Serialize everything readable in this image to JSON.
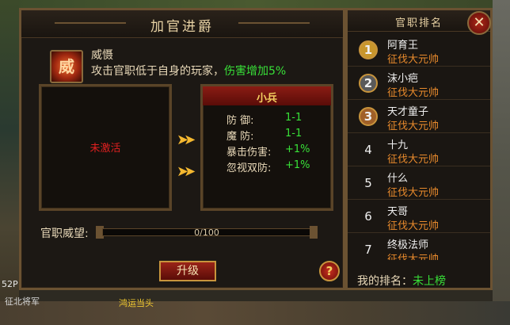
{
  "window": {
    "title": "加官进爵"
  },
  "skill": {
    "icon": "flame-skill-icon",
    "icon_glyph": "威",
    "name": "威慑",
    "desc_prefix": "攻击官职低于自身的玩家，",
    "desc_highlight": "伤害增加5%"
  },
  "left_panel": {
    "status": "未激活"
  },
  "right_panel": {
    "header": "小兵",
    "stats": [
      {
        "label": "防    御:",
        "value": "1-1"
      },
      {
        "label": "魔    防:",
        "value": "1-1"
      },
      {
        "label": "暴击伤害:",
        "value": "+1%"
      },
      {
        "label": "忽视双防:",
        "value": "+1%"
      }
    ]
  },
  "progress": {
    "label": "官职威望:",
    "current": 0,
    "max": 100,
    "text": "0/100"
  },
  "buttons": {
    "upgrade": "升级",
    "help": "?",
    "close": "✕"
  },
  "ranking": {
    "title": "官职排名",
    "rows": [
      {
        "rank": "1",
        "name": "阿育王",
        "title": "征伐大元帅"
      },
      {
        "rank": "2",
        "name": "沫小疤",
        "title": "征伐大元帅"
      },
      {
        "rank": "3",
        "name": "天才童子",
        "title": "征伐大元帅"
      },
      {
        "rank": "4",
        "name": "十九",
        "title": "征伐大元帅"
      },
      {
        "rank": "5",
        "name": "什么",
        "title": "征伐大元帅"
      },
      {
        "rank": "6",
        "name": "天哥",
        "title": "征伐大元帅"
      },
      {
        "rank": "7",
        "name": "终极法师",
        "title": "征伐大元帅"
      }
    ],
    "my_rank_label": "我的排名：",
    "my_rank_value": "未上榜"
  },
  "background": {
    "bottom_left_text": "征北将军",
    "bottom_name": "鸿运当头",
    "level_text": "52P"
  },
  "colors": {
    "highlight_green": "#38e038",
    "title_orange": "#e88a2c",
    "header_red": "#8a1c14",
    "frame_gold": "#6b5232"
  }
}
